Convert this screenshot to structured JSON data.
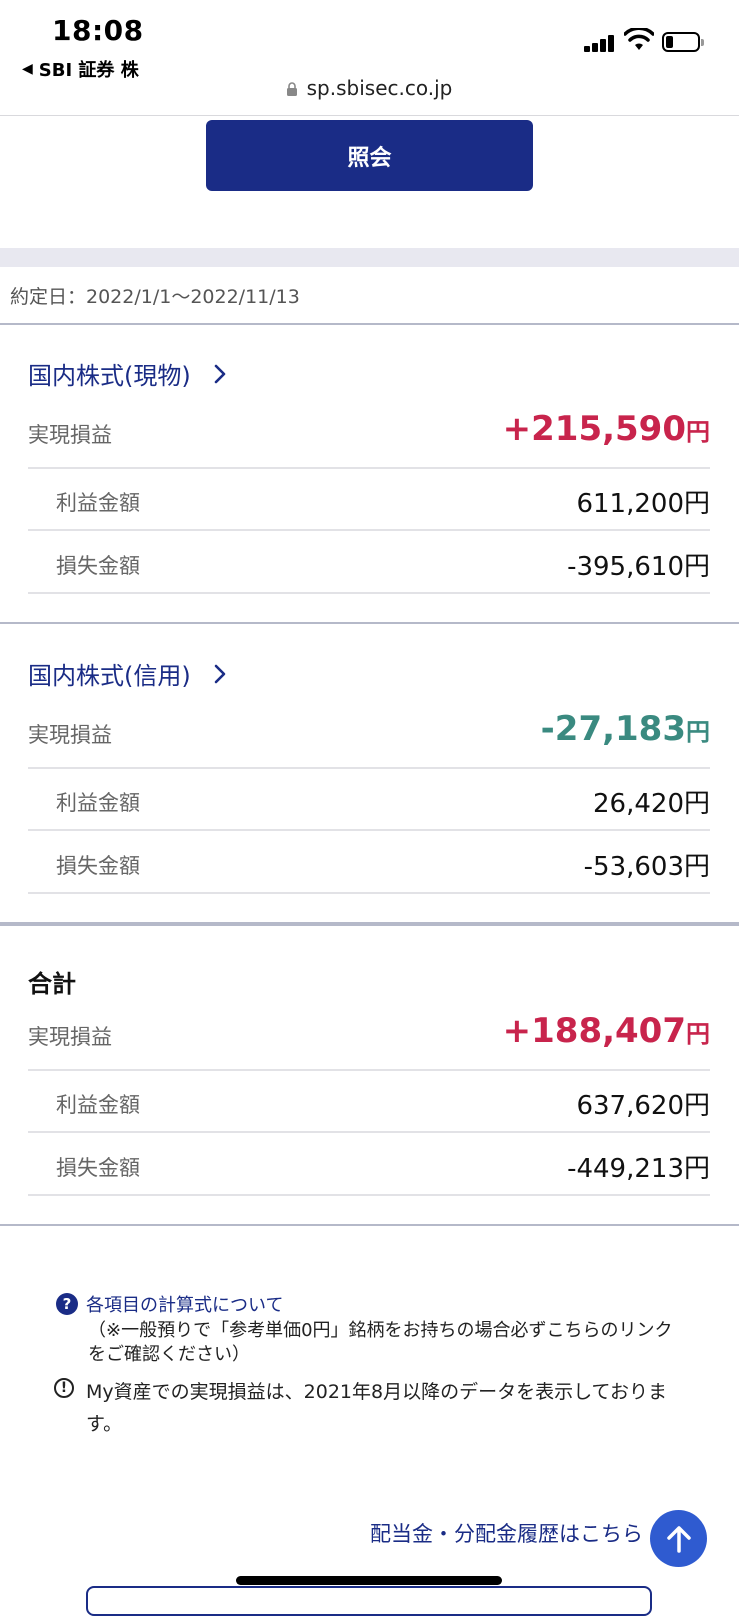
{
  "status_bar": {
    "time": "18:08",
    "back_app": "SBI 証券 株",
    "url": "sp.sbisec.co.jp"
  },
  "search_button_label": "照会",
  "date_range": "約定日：2022/1/1〜2022/11/13",
  "sections": [
    {
      "title": "国内株式(現物)",
      "realized_label": "実現損益",
      "realized_value": "+215,590",
      "profit_label": "利益金額",
      "profit_value": "611,200円",
      "loss_label": "損失金額",
      "loss_value": "-395,610円"
    },
    {
      "title": "国内株式(信用)",
      "realized_label": "実現損益",
      "realized_value": "-27,183",
      "profit_label": "利益金額",
      "profit_value": "26,420円",
      "loss_label": "損失金額",
      "loss_value": "-53,603円"
    },
    {
      "title": "合計",
      "realized_label": "実現損益",
      "realized_value": "+188,407",
      "profit_label": "利益金額",
      "profit_value": "637,620円",
      "loss_label": "損失金額",
      "loss_value": "-449,213円"
    }
  ],
  "yen_unit": "円",
  "notes": {
    "formula_link": "各項目の計算式について",
    "formula_note": "（※一般預りで「参考単価0円」銘柄をお持ちの場合必ずこちらのリンクをご確認ください）",
    "info_text": "My資産での実現損益は、2021年8月以降のデータを表示しております。"
  },
  "dividend_link": "配当金・分配金履歴はこちら",
  "colors": {
    "brand_navy": "#1a2c86",
    "positive": "#c8244c",
    "negative": "#3a8a80",
    "scroll_button": "#2f5bd0"
  }
}
